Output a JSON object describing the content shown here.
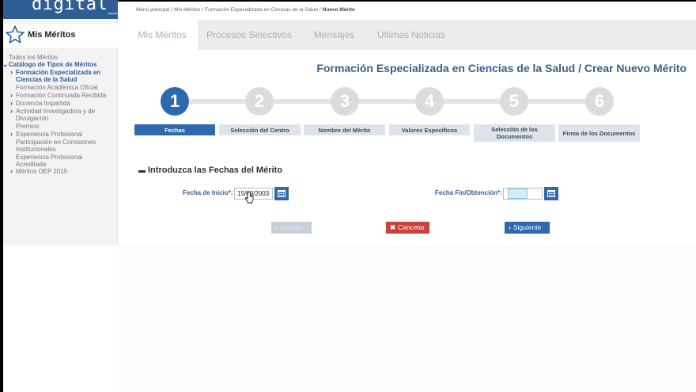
{
  "logo": {
    "text": "digital_"
  },
  "sidebar": {
    "title": "Mis Méritos",
    "icon": "star-icon",
    "tree": [
      {
        "label": "Todos los Méritos",
        "type": "root"
      },
      {
        "label": "Catálogo de Tipos de Méritos",
        "type": "category",
        "expanded": true
      },
      {
        "label": "Formación Especializada en Ciencias de la Salud",
        "type": "item",
        "active": true
      },
      {
        "label": "Formación Académica Oficial",
        "type": "item"
      },
      {
        "label": "Formación Continuada Recibida",
        "type": "item"
      },
      {
        "label": "Docencia Impartida",
        "type": "item"
      },
      {
        "label": "Actividad Investigadora y de Divulgación",
        "type": "item"
      },
      {
        "label": "Premios",
        "type": "item"
      },
      {
        "label": "Experiencia Profesional",
        "type": "item"
      },
      {
        "label": "Participación en Comisiones Institucionales",
        "type": "item"
      },
      {
        "label": "Experiencia Profesional Acreditada",
        "type": "item"
      },
      {
        "label": "Méritos OEP 2015",
        "type": "item"
      }
    ]
  },
  "breadcrumb": {
    "items": [
      "Menú principal",
      "Mis Méritos",
      "Formación Especializada en Ciencias de la Salud"
    ],
    "current": "Nuevo Mérito",
    "separator": "/"
  },
  "tabs": [
    {
      "label": "Mis Méritos",
      "active": true
    },
    {
      "label": "Procesos Selectivos",
      "active": false
    },
    {
      "label": "Mensajes",
      "active": false
    },
    {
      "label": "Últimas Noticias",
      "active": false
    }
  ],
  "page_title": "Formación Especializada en Ciencias de la Salud / Crear Nuevo Mérito",
  "wizard": {
    "current_step": 1,
    "steps": [
      {
        "number": "1",
        "label": "Fechas"
      },
      {
        "number": "2",
        "label": "Selección del Centro"
      },
      {
        "number": "3",
        "label": "Nombre del Mérito"
      },
      {
        "number": "4",
        "label": "Valores Específicos"
      },
      {
        "number": "5",
        "label": "Selección de los Documentos"
      },
      {
        "number": "6",
        "label": "Firma de los Documentos"
      }
    ]
  },
  "section": {
    "title": "Introduzca las Fechas del Mérito",
    "start_label": "Fecha de Inicio*:",
    "start_value": "15/09/2003",
    "end_label": "Fecha Fin/Obtención*:",
    "end_value": ""
  },
  "buttons": {
    "prev": "Anterior",
    "cancel": "Cancelar",
    "next": "Siguiente"
  },
  "colors": {
    "primary": "#2f69ad",
    "header_blue": "#2f5e95",
    "title_blue": "#3a5f8a",
    "cancel_red": "#c8413a",
    "disabled": "#c7cfd9"
  }
}
